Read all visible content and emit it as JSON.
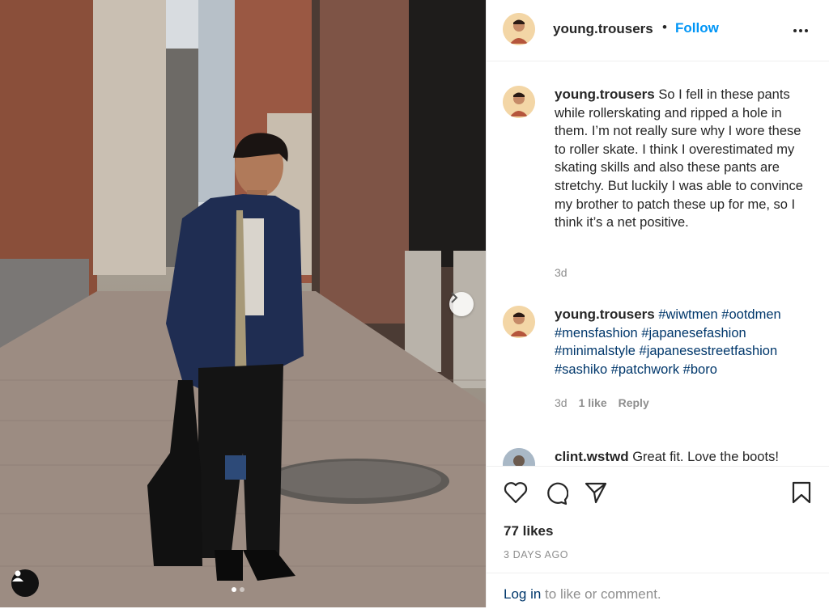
{
  "post": {
    "username": "young.trousers",
    "separator": "•",
    "follow_label": "Follow",
    "more_icon": "more-horizontal-icon",
    "caption": {
      "username": "young.trousers",
      "text": "So I fell in these pants while rollerskating and ripped a hole in them. I’m not really sure why I wore these to roller skate. I think I overestimated my skating skills and also these pants are stretchy. But luckily I was able to convince my brother to patch these up for me, so I think it’s a net positive.",
      "age": "3d"
    },
    "comments": [
      {
        "username": "young.trousers",
        "text": "#wiwtmen #ootdmen #mensfashion #japanesefashion #minimalstyle #japanesestreetfashion #sashiko #patchwork #boro",
        "age": "3d",
        "likes": "1 like",
        "reply_label": "Reply"
      },
      {
        "username": "clint.wstwd",
        "text": "Great fit. Love the boots!"
      }
    ],
    "likes_label": "77 likes",
    "date_label": "3 DAYS AGO",
    "login_prompt": {
      "link": "Log in",
      "rest": " to like or comment."
    },
    "carousel": {
      "current": 1,
      "total": 2
    }
  }
}
